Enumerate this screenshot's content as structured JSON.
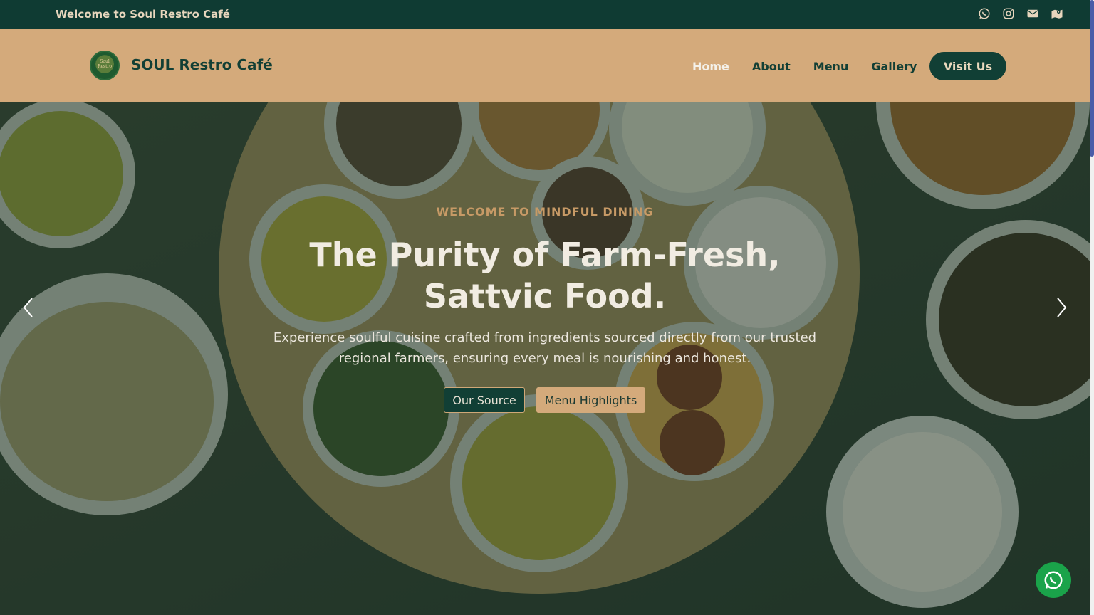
{
  "topbar": {
    "welcome_text": "Welcome to Soul Restro Café",
    "icons": [
      "whatsapp-icon",
      "instagram-icon",
      "envelope-icon",
      "map-icon"
    ]
  },
  "navbar": {
    "brand": "SOUL Restro Café",
    "logo_text": "Soul Restro",
    "links": [
      "Home",
      "About",
      "Menu",
      "Gallery"
    ],
    "active_link": "Home",
    "cta": "Visit Us"
  },
  "hero": {
    "kicker": "WELCOME TO MINDFUL DINING",
    "headline_line1": "The Purity of Farm-Fresh,",
    "headline_line2": "Sattvic Food.",
    "subtext": "Experience soulful cuisine crafted from ingredients sourced directly from our trusted regional farmers, ensuring every meal is nourishing and honest.",
    "primary_button": "Our Source",
    "secondary_button": "Menu Highlights"
  },
  "colors": {
    "dark_green": "#0f3b33",
    "tan": "#d4aa7b",
    "cream": "#e9d8bd",
    "whatsapp_green": "#1aa34a"
  }
}
